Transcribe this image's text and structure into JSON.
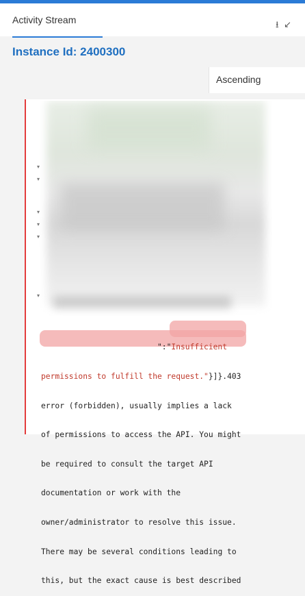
{
  "header": {
    "tab_label": "Activity Stream",
    "tool_icons": "⭳ ↙"
  },
  "title": "Instance Id: 2400300",
  "sort": {
    "value": "Ascending"
  },
  "log": {
    "line1_prefix": "\":\"",
    "line1_highlight": "Insufficient",
    "line2_highlight": "permissions to fulfill the request.\"",
    "line2_suffix": "}]}.403",
    "lines": [
      "error (forbidden), usually implies a lack",
      "of permissions to access the API. You might",
      "be required to consult the target API",
      "documentation or work with the",
      "owner/administrator to resolve this issue.",
      "There may be several conditions leading to",
      "this, but the exact cause is best described"
    ]
  }
}
